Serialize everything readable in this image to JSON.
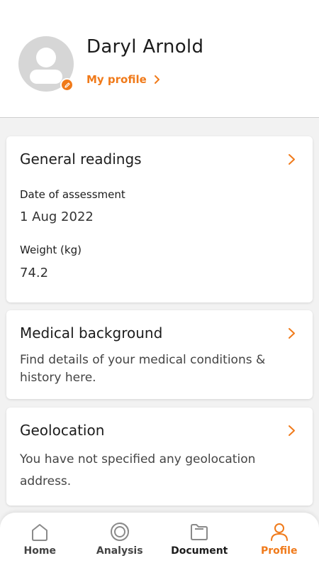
{
  "colors": {
    "accent": "#f07a1a",
    "background": "#f2f2f2"
  },
  "profile": {
    "name": "Daryl Arnold",
    "link_label": "My profile"
  },
  "general_readings": {
    "title": "General readings",
    "fields": [
      {
        "label": "Date of assessment",
        "value": "1 Aug 2022"
      },
      {
        "label": "Weight (kg)",
        "value": "74.2"
      }
    ]
  },
  "medical_background": {
    "title": "Medical background",
    "description": "Find details of your medical conditions & history here."
  },
  "geolocation": {
    "title": "Geolocation",
    "description": "You have not specified any geolocation address."
  },
  "nav": {
    "items": [
      {
        "label": "Home",
        "icon": "home-icon"
      },
      {
        "label": "Analysis",
        "icon": "analysis-icon"
      },
      {
        "label": "Document",
        "icon": "folder-icon"
      },
      {
        "label": "Profile",
        "icon": "user-icon",
        "active": true
      }
    ]
  }
}
